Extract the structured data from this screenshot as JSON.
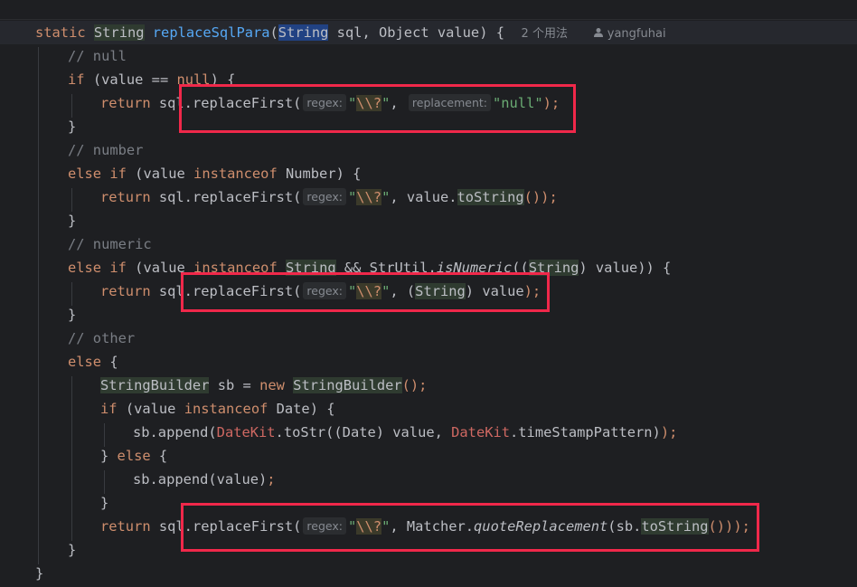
{
  "editor": {
    "method_usages_hint": "2 个用法",
    "author": "yangfuhai",
    "lines": {
      "l1": {
        "kw": "static",
        "type": "String",
        "name": "replaceSqlPara",
        "paren": "(",
        "ptype": "String",
        "rest": " sql, Object value) {"
      },
      "l2": {
        "comment": "// null"
      },
      "l3": {
        "kw": "if",
        "a": " (value == ",
        "null_kw": "null",
        "b": ") {"
      },
      "l4": {
        "kw": "return",
        "a": " sql.replaceFirst(",
        "hint1": "regex:",
        "s1q": "\"",
        "s1": "\\\\?",
        "s1e": "\"",
        "c": ", ",
        "hint2": "replacement:",
        "s2": "\"null\"",
        "end": ");"
      },
      "l5": {
        "text": "}"
      },
      "l6": {
        "comment": "// number"
      },
      "l7": {
        "kw1": "else",
        "kw2": "if",
        "a": " (value ",
        "kw3": "instanceof",
        "b": " Number) {"
      },
      "l8": {
        "kw": "return",
        "a": " sql.replaceFirst(",
        "hint1": "regex:",
        "s1q": "\"",
        "s1": "\\\\?",
        "s1e": "\"",
        "c": ", value.",
        "m": "toString",
        "end": "());"
      },
      "l9": {
        "text": "}"
      },
      "l10": {
        "comment": "// numeric"
      },
      "l11": {
        "kw1": "else",
        "kw2": "if",
        "a": " (value ",
        "kw3": "instanceof",
        "sp": " ",
        "t1": "String",
        "b": " && StrUtil.",
        "m": "isNumeric",
        "c": "((",
        "t2": "String",
        "d": ") value)) {"
      },
      "l12": {
        "kw": "return",
        "a": " sql.replaceFirst(",
        "hint1": "regex:",
        "s1q": "\"",
        "s1": "\\\\?",
        "s1e": "\"",
        "c": ", (",
        "t": "String",
        "d": ") value",
        "end": ");"
      },
      "l13": {
        "text": "}"
      },
      "l14": {
        "comment": "// other"
      },
      "l15": {
        "kw": "else",
        "a": " {"
      },
      "l16": {
        "t1": "StringBuilder",
        "a": " sb = ",
        "kw": "new",
        "sp": " ",
        "t2": "StringBuilder",
        "end": "();"
      },
      "l17": {
        "kw": "if",
        "a": " (value ",
        "kw2": "instanceof",
        "b": " Date) {"
      },
      "l18": {
        "a": "sb.append(",
        "dk1": "DateKit",
        "b": ".toStr((Date) value, ",
        "dk2": "DateKit",
        "c": ".timeStampPattern)",
        "end": ");"
      },
      "l19": {
        "a": "} ",
        "kw": "else",
        "b": " {"
      },
      "l20": {
        "a": "sb.append(value)",
        "end": ";"
      },
      "l21": {
        "text": "}"
      },
      "l22": {
        "kw": "return",
        "a": " sql.replaceFirst(",
        "hint1": "regex:",
        "s1q": "\"",
        "s1": "\\\\?",
        "s1e": "\"",
        "c": ", Matcher.",
        "m": "quoteReplacement",
        "d": "(sb.",
        "m2": "toString",
        "end": "()));"
      },
      "l23": {
        "text": "}"
      },
      "l24": {
        "text": "}"
      }
    }
  },
  "colors": {
    "background": "#1e1f22",
    "keyword": "#cf8e6d",
    "method": "#56a8f5",
    "string": "#6aab73",
    "comment": "#7a7e85",
    "highlight_box": "#f0284a"
  }
}
